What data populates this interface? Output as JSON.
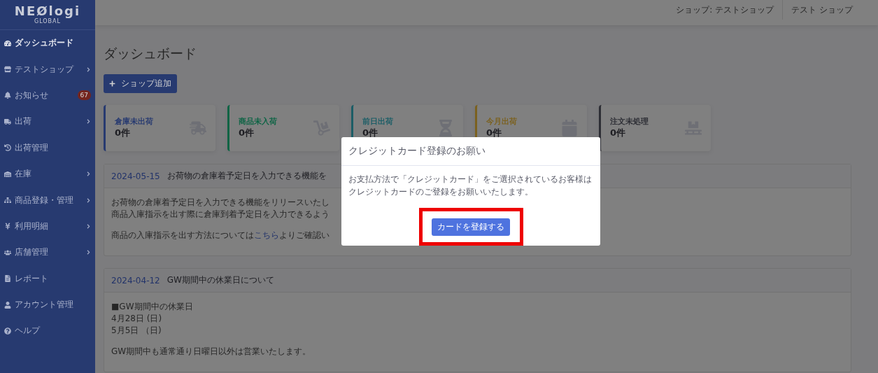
{
  "logo": {
    "name": "NEØlogi",
    "sub": "GLOBAL"
  },
  "sidebar": {
    "items": [
      {
        "label": "ダッシュボード",
        "selected": true,
        "submenu": false
      },
      {
        "label": "テストショップ",
        "selected": false,
        "submenu": true
      },
      {
        "label": "お知らせ",
        "selected": false,
        "submenu": false,
        "badge": "67"
      },
      {
        "label": "出荷",
        "selected": false,
        "submenu": true
      },
      {
        "label": "出荷管理",
        "selected": false,
        "submenu": false
      },
      {
        "label": "在庫",
        "selected": false,
        "submenu": true
      },
      {
        "label": "商品登録・管理",
        "selected": false,
        "submenu": true
      },
      {
        "label": "利用明細",
        "selected": false,
        "submenu": true
      },
      {
        "label": "店舗管理",
        "selected": false,
        "submenu": true
      },
      {
        "label": "レポート",
        "selected": false,
        "submenu": false
      },
      {
        "label": "アカウント管理",
        "selected": false,
        "submenu": false
      },
      {
        "label": "ヘルプ",
        "selected": false,
        "submenu": false
      }
    ]
  },
  "topbar": {
    "shop": "ショップ: テストショップ",
    "user": "テスト ショップ"
  },
  "page_title": "ダッシュボード",
  "add_shop_button": "ショップ追加",
  "stat_cards": [
    {
      "label": "倉庫未出荷",
      "value": "0件",
      "color": "#273a70"
    },
    {
      "label": "商品未入荷",
      "value": "0件",
      "color": "#0e6445"
    },
    {
      "label": "前日出荷",
      "value": "0件",
      "color": "#1b5d66"
    },
    {
      "label": "今月出荷",
      "value": "0件",
      "color": "#7b611f"
    },
    {
      "label": "注文未処理",
      "value": "0件",
      "color": "#2d2e35"
    }
  ],
  "announcements": [
    {
      "date": "2024-05-15",
      "title": "お荷物の倉庫着予定日を入力できる機能を",
      "paragraphs": [
        [
          {
            "text": "お荷物の倉庫着予定日を入力できる機能をリリースいたし"
          },
          {
            "text": "商品入庫指示を出す際に倉庫到着予定日を入力できるよう"
          }
        ],
        [
          {
            "text": "商品の入庫指示を出す方法については",
            "link": "こちら",
            "after": "よりご確認い"
          }
        ]
      ]
    },
    {
      "date": "2024-04-12",
      "title": "GW期間中の休業日について",
      "paragraphs": [
        [
          {
            "text": "■GW期間中の休業日"
          },
          {
            "text": "4月28日 (日)"
          },
          {
            "text": "5月5日 （日)"
          }
        ],
        [
          {
            "text": "GW期間中も通常通り日曜日以外は営業いたします。"
          }
        ]
      ]
    }
  ],
  "modal": {
    "title": "クレジットカード登録のお願い",
    "lines": [
      "お支払方法で「クレジットカード」をご選択されているお客様は",
      "クレジットカードのご登録をお願いいたします。"
    ],
    "button": "カードを登録する",
    "highlighted": true
  }
}
